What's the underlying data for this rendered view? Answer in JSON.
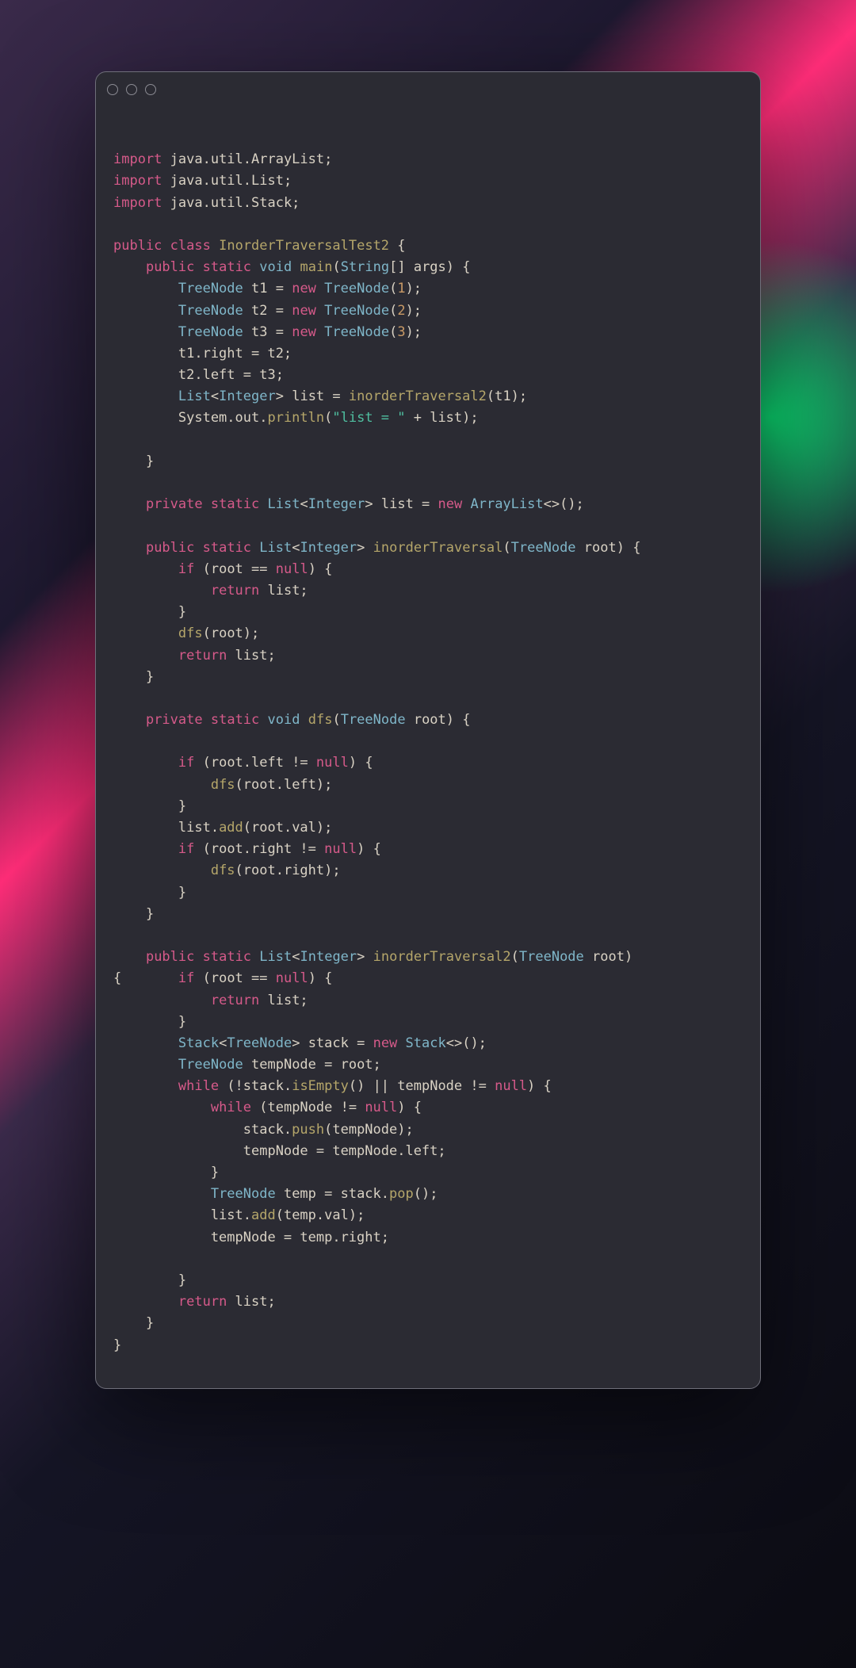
{
  "code": {
    "lines": [
      [],
      [
        {
          "c": "kw",
          "t": "import"
        },
        {
          "t": " java.util.ArrayList;"
        }
      ],
      [
        {
          "c": "kw",
          "t": "import"
        },
        {
          "t": " java.util.List;"
        }
      ],
      [
        {
          "c": "kw",
          "t": "import"
        },
        {
          "t": " java.util.Stack;"
        }
      ],
      [],
      [
        {
          "c": "kw",
          "t": "public"
        },
        {
          "t": " "
        },
        {
          "c": "kw",
          "t": "class"
        },
        {
          "t": " "
        },
        {
          "c": "fn",
          "t": "InorderTraversalTest2"
        },
        {
          "t": " {"
        }
      ],
      [
        {
          "t": "    "
        },
        {
          "c": "kw",
          "t": "public"
        },
        {
          "t": " "
        },
        {
          "c": "kw",
          "t": "static"
        },
        {
          "t": " "
        },
        {
          "c": "type",
          "t": "void"
        },
        {
          "t": " "
        },
        {
          "c": "fn",
          "t": "main"
        },
        {
          "t": "("
        },
        {
          "c": "type",
          "t": "String"
        },
        {
          "t": "[] args) {"
        }
      ],
      [
        {
          "t": "        "
        },
        {
          "c": "type",
          "t": "TreeNode"
        },
        {
          "t": " t1 = "
        },
        {
          "c": "kw",
          "t": "new"
        },
        {
          "t": " "
        },
        {
          "c": "type",
          "t": "TreeNode"
        },
        {
          "t": "("
        },
        {
          "c": "num",
          "t": "1"
        },
        {
          "t": ");"
        }
      ],
      [
        {
          "t": "        "
        },
        {
          "c": "type",
          "t": "TreeNode"
        },
        {
          "t": " t2 = "
        },
        {
          "c": "kw",
          "t": "new"
        },
        {
          "t": " "
        },
        {
          "c": "type",
          "t": "TreeNode"
        },
        {
          "t": "("
        },
        {
          "c": "num",
          "t": "2"
        },
        {
          "t": ");"
        }
      ],
      [
        {
          "t": "        "
        },
        {
          "c": "type",
          "t": "TreeNode"
        },
        {
          "t": " t3 = "
        },
        {
          "c": "kw",
          "t": "new"
        },
        {
          "t": " "
        },
        {
          "c": "type",
          "t": "TreeNode"
        },
        {
          "t": "("
        },
        {
          "c": "num",
          "t": "3"
        },
        {
          "t": ");"
        }
      ],
      [
        {
          "t": "        t1.right = t2;"
        }
      ],
      [
        {
          "t": "        t2.left = t3;"
        }
      ],
      [
        {
          "t": "        "
        },
        {
          "c": "type",
          "t": "List"
        },
        {
          "t": "<"
        },
        {
          "c": "type",
          "t": "Integer"
        },
        {
          "t": "> list = "
        },
        {
          "c": "fn",
          "t": "inorderTraversal2"
        },
        {
          "t": "(t1);"
        }
      ],
      [
        {
          "t": "        System.out."
        },
        {
          "c": "fn",
          "t": "println"
        },
        {
          "t": "("
        },
        {
          "c": "str",
          "t": "\"list = \""
        },
        {
          "t": " + list);"
        }
      ],
      [],
      [
        {
          "t": "    }"
        }
      ],
      [],
      [
        {
          "t": "    "
        },
        {
          "c": "kw",
          "t": "private"
        },
        {
          "t": " "
        },
        {
          "c": "kw",
          "t": "static"
        },
        {
          "t": " "
        },
        {
          "c": "type",
          "t": "List"
        },
        {
          "t": "<"
        },
        {
          "c": "type",
          "t": "Integer"
        },
        {
          "t": "> list = "
        },
        {
          "c": "kw",
          "t": "new"
        },
        {
          "t": " "
        },
        {
          "c": "type",
          "t": "ArrayList"
        },
        {
          "t": "<>();"
        }
      ],
      [],
      [
        {
          "t": "    "
        },
        {
          "c": "kw",
          "t": "public"
        },
        {
          "t": " "
        },
        {
          "c": "kw",
          "t": "static"
        },
        {
          "t": " "
        },
        {
          "c": "type",
          "t": "List"
        },
        {
          "t": "<"
        },
        {
          "c": "type",
          "t": "Integer"
        },
        {
          "t": "> "
        },
        {
          "c": "fn",
          "t": "inorderTraversal"
        },
        {
          "t": "("
        },
        {
          "c": "type",
          "t": "TreeNode"
        },
        {
          "t": " root) {"
        }
      ],
      [
        {
          "t": "        "
        },
        {
          "c": "kw",
          "t": "if"
        },
        {
          "t": " (root == "
        },
        {
          "c": "lit",
          "t": "null"
        },
        {
          "t": ") {"
        }
      ],
      [
        {
          "t": "            "
        },
        {
          "c": "kw",
          "t": "return"
        },
        {
          "t": " list;"
        }
      ],
      [
        {
          "t": "        }"
        }
      ],
      [
        {
          "t": "        "
        },
        {
          "c": "fn",
          "t": "dfs"
        },
        {
          "t": "(root);"
        }
      ],
      [
        {
          "t": "        "
        },
        {
          "c": "kw",
          "t": "return"
        },
        {
          "t": " list;"
        }
      ],
      [
        {
          "t": "    }"
        }
      ],
      [],
      [
        {
          "t": "    "
        },
        {
          "c": "kw",
          "t": "private"
        },
        {
          "t": " "
        },
        {
          "c": "kw",
          "t": "static"
        },
        {
          "t": " "
        },
        {
          "c": "type",
          "t": "void"
        },
        {
          "t": " "
        },
        {
          "c": "fn",
          "t": "dfs"
        },
        {
          "t": "("
        },
        {
          "c": "type",
          "t": "TreeNode"
        },
        {
          "t": " root) {"
        }
      ],
      [],
      [
        {
          "t": "        "
        },
        {
          "c": "kw",
          "t": "if"
        },
        {
          "t": " (root.left != "
        },
        {
          "c": "lit",
          "t": "null"
        },
        {
          "t": ") {"
        }
      ],
      [
        {
          "t": "            "
        },
        {
          "c": "fn",
          "t": "dfs"
        },
        {
          "t": "(root.left);"
        }
      ],
      [
        {
          "t": "        }"
        }
      ],
      [
        {
          "t": "        list."
        },
        {
          "c": "fn",
          "t": "add"
        },
        {
          "t": "(root.val);"
        }
      ],
      [
        {
          "t": "        "
        },
        {
          "c": "kw",
          "t": "if"
        },
        {
          "t": " (root.right != "
        },
        {
          "c": "lit",
          "t": "null"
        },
        {
          "t": ") {"
        }
      ],
      [
        {
          "t": "            "
        },
        {
          "c": "fn",
          "t": "dfs"
        },
        {
          "t": "(root.right);"
        }
      ],
      [
        {
          "t": "        }"
        }
      ],
      [
        {
          "t": "    }"
        }
      ],
      [],
      [
        {
          "t": "    "
        },
        {
          "c": "kw",
          "t": "public"
        },
        {
          "t": " "
        },
        {
          "c": "kw",
          "t": "static"
        },
        {
          "t": " "
        },
        {
          "c": "type",
          "t": "List"
        },
        {
          "t": "<"
        },
        {
          "c": "type",
          "t": "Integer"
        },
        {
          "t": "> "
        },
        {
          "c": "fn",
          "t": "inorderTraversal2"
        },
        {
          "t": "("
        },
        {
          "c": "type",
          "t": "TreeNode"
        },
        {
          "t": " root) "
        }
      ],
      [
        {
          "t": "{       "
        },
        {
          "c": "kw",
          "t": "if"
        },
        {
          "t": " (root == "
        },
        {
          "c": "lit",
          "t": "null"
        },
        {
          "t": ") {"
        }
      ],
      [
        {
          "t": "            "
        },
        {
          "c": "kw",
          "t": "return"
        },
        {
          "t": " list;"
        }
      ],
      [
        {
          "t": "        }"
        }
      ],
      [
        {
          "t": "        "
        },
        {
          "c": "type",
          "t": "Stack"
        },
        {
          "t": "<"
        },
        {
          "c": "type",
          "t": "TreeNode"
        },
        {
          "t": "> stack = "
        },
        {
          "c": "kw",
          "t": "new"
        },
        {
          "t": " "
        },
        {
          "c": "type",
          "t": "Stack"
        },
        {
          "t": "<>();"
        }
      ],
      [
        {
          "t": "        "
        },
        {
          "c": "type",
          "t": "TreeNode"
        },
        {
          "t": " tempNode = root;"
        }
      ],
      [
        {
          "t": "        "
        },
        {
          "c": "kw",
          "t": "while"
        },
        {
          "t": " (!stack."
        },
        {
          "c": "fn",
          "t": "isEmpty"
        },
        {
          "t": "() || tempNode != "
        },
        {
          "c": "lit",
          "t": "null"
        },
        {
          "t": ") {"
        }
      ],
      [
        {
          "t": "            "
        },
        {
          "c": "kw",
          "t": "while"
        },
        {
          "t": " (tempNode != "
        },
        {
          "c": "lit",
          "t": "null"
        },
        {
          "t": ") {"
        }
      ],
      [
        {
          "t": "                stack."
        },
        {
          "c": "fn",
          "t": "push"
        },
        {
          "t": "(tempNode);"
        }
      ],
      [
        {
          "t": "                tempNode = tempNode.left;"
        }
      ],
      [
        {
          "t": "            }"
        }
      ],
      [
        {
          "t": "            "
        },
        {
          "c": "type",
          "t": "TreeNode"
        },
        {
          "t": " temp = stack."
        },
        {
          "c": "fn",
          "t": "pop"
        },
        {
          "t": "();"
        }
      ],
      [
        {
          "t": "            list."
        },
        {
          "c": "fn",
          "t": "add"
        },
        {
          "t": "(temp.val);"
        }
      ],
      [
        {
          "t": "            tempNode = temp.right;"
        }
      ],
      [],
      [
        {
          "t": "        }"
        }
      ],
      [
        {
          "t": "        "
        },
        {
          "c": "kw",
          "t": "return"
        },
        {
          "t": " list;"
        }
      ],
      [
        {
          "t": "    }"
        }
      ],
      [
        {
          "t": "}"
        }
      ]
    ]
  }
}
